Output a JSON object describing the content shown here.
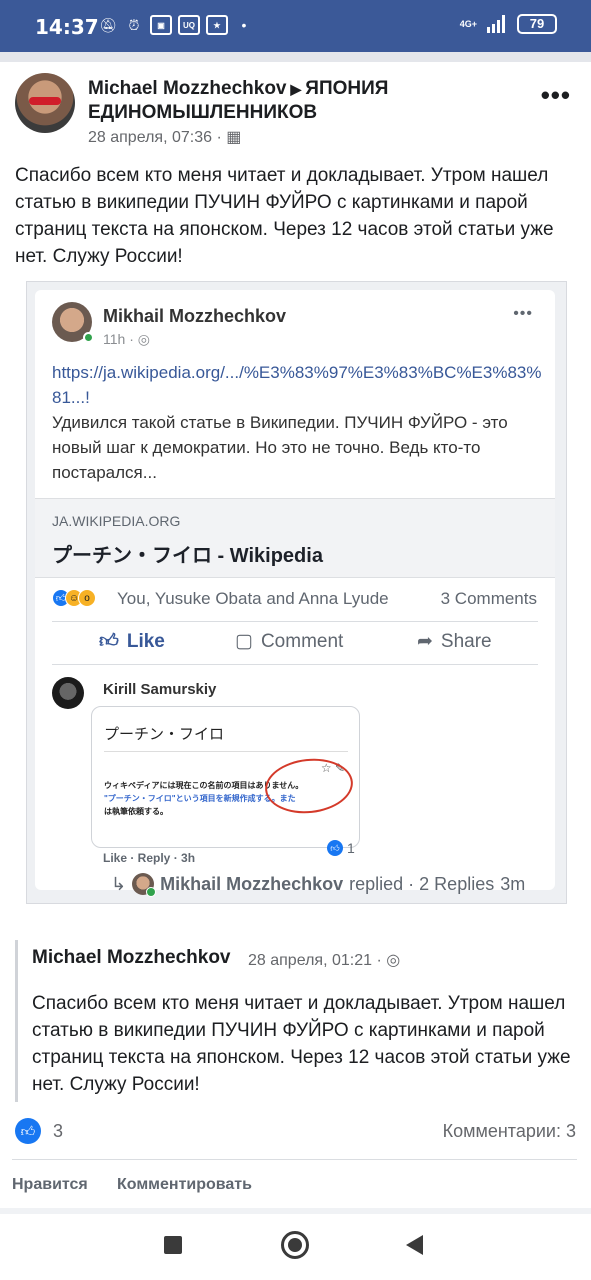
{
  "status_bar": {
    "time": "14:37",
    "network": "4G+",
    "battery": "79"
  },
  "post": {
    "author": "Michael Mozzhechkov",
    "group": "ЯПОНИЯ ЕДИНОМЫШЛЕННИКОВ",
    "date": "28 апреля, 07:36 ·",
    "text": "Спасибо всем кто меня читает и докладывает. Утром нашел статью в википедии ПУЧИН ФУЙРО с картинками и парой страниц текста на японском. Через 12 часов этой статьи уже нет. Служу России!"
  },
  "screenshot": {
    "author": "Mikhail Mozzhechkov",
    "time": "11h ·",
    "link": "https://ja.wikipedia.org/.../%E3%83%97%E3%83%BC%E3%83%81...!",
    "text": "Удивился такой статье в Википедии. ПУЧИН ФУЙРО - это новый шаг к демократии. Но это не точно. Ведь кто-то постарался...",
    "preview_domain": "JA.WIKIPEDIA.ORG",
    "preview_title": "プーチン・フイロ - Wikipedia",
    "reactions_names": "You, Yusuke Obata and Anna Lyude",
    "reactions_comments": "3 Comments",
    "actions": {
      "like": "Like",
      "comment": "Comment",
      "share": "Share"
    },
    "comment": {
      "author": "Kirill Samurskiy",
      "image_title": "プーチン・フイロ",
      "image_line1": "ウィキペディアには現在この名前の項目はありません。",
      "image_line2": "\"プーチン・フイロ\"という項目を新規作成する。また",
      "image_line3": "は執筆依頼する。",
      "meta": "Like · Reply · 3h",
      "likes": "1"
    },
    "reply_author": "Mikhail Mozzhechkov",
    "reply_text": "replied · 2 Replies",
    "reply_time": "3m"
  },
  "shared": {
    "author": "Michael Mozzhechkov",
    "date": "28 апреля, 01:21 ·",
    "text": "Спасибо всем кто меня читает и докладывает. Утром нашел статью в википедии ПУЧИН ФУЙРО с картинками и парой страниц текста на японском. Через 12 часов этой статьи уже нет. Служу России!"
  },
  "footer": {
    "likes": "3",
    "comments": "Комментарии: 3",
    "like_button": "Нравится",
    "comment_button": "Комментировать"
  },
  "colors": {
    "status_bar": "#3b5998",
    "facebook_blue": "#1877f2",
    "link": "#385898"
  }
}
